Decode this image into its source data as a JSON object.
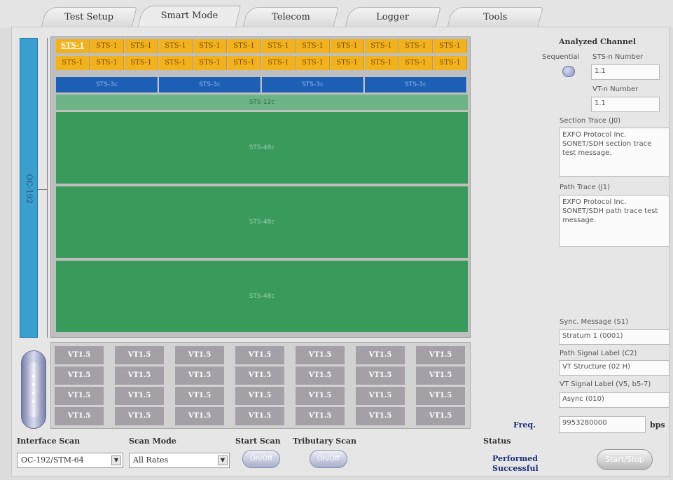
{
  "tabs": [
    {
      "label": "Test Setup"
    },
    {
      "label": "Smart Mode"
    },
    {
      "label": "Telecom"
    },
    {
      "label": "Logger"
    },
    {
      "label": "Tools"
    }
  ],
  "oc_label": "OC-192",
  "sts1_rows": [
    [
      "STS-1",
      "STS-1",
      "STS-1",
      "STS-1",
      "STS-1",
      "STS-1",
      "STS-1",
      "STS-1",
      "STS-1",
      "STS-1",
      "STS-1",
      "STS-1"
    ],
    [
      "STS-1",
      "STS-1",
      "STS-1",
      "STS-1",
      "STS-1",
      "STS-1",
      "STS-1",
      "STS-1",
      "STS-1",
      "STS-1",
      "STS-1",
      "STS-1"
    ]
  ],
  "sts3c": [
    "STS-3c",
    "STS-3c",
    "STS-3c",
    "STS-3c"
  ],
  "sts12c": "STS-12c",
  "sts48c": [
    "STS-48c",
    "STS-48c",
    "STS-48c"
  ],
  "vt_cell_label": "VT1.5",
  "vt_rows": 4,
  "vt_cols": 7,
  "right": {
    "analyzed_channel": "Analyzed Channel",
    "sequential": "Sequential",
    "sts_n_number_label": "STS-n Number",
    "sts_n_number_value": "1.1",
    "vt_n_number_label": "VT-n Number",
    "vt_n_number_value": "1.1",
    "section_trace_label": "Section Trace (J0)",
    "section_trace_value": "EXFO Protocol Inc. SONET/SDH section trace test message.",
    "path_trace_label": "Path Trace (J1)",
    "path_trace_value": "EXFO Protocol Inc. SONET/SDH path trace test message.",
    "sync_message_label": "Sync. Message (S1)",
    "sync_message_value": "Stratum 1 (0001)",
    "path_signal_label": "Path Signal Label (C2)",
    "path_signal_value": "VT Structure (02 H)",
    "vt_signal_label": "VT Signal Label (V5, b5-7)",
    "vt_signal_value": "Async (010)",
    "freq_label": "Freq.",
    "freq_value": "9953280000",
    "freq_unit": "bps"
  },
  "bottom": {
    "interface_scan_label": "Interface Scan",
    "interface_scan_value": "OC-192/STM-64",
    "scan_mode_label": "Scan Mode",
    "scan_mode_value": "All Rates",
    "start_scan_label": "Start Scan",
    "start_scan_button": "On/Off",
    "tributary_scan_label": "Tributary Scan",
    "tributary_scan_button": "On/Off",
    "status_label": "Status",
    "status_value_line1": "Performed",
    "status_value_line2": "Successful",
    "start_button": "Start/Stop"
  },
  "colors": {
    "sts1": "#f2b21d",
    "sts3c": "#1e5fb6",
    "sts12c": "#6cb387",
    "sts48c": "#3a9a5c",
    "vt": "#a5a0a7",
    "oc_bar": "#3a9fcf"
  }
}
